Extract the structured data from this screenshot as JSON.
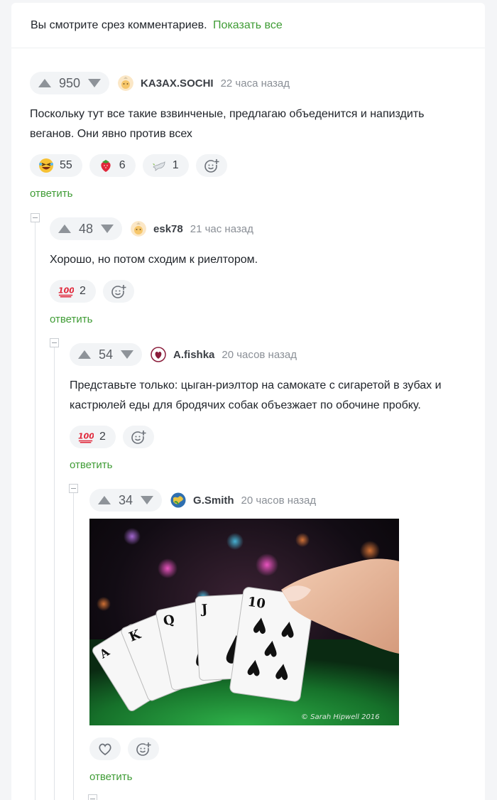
{
  "banner": {
    "text": "Вы смотрите срез комментариев.",
    "link": "Показать все"
  },
  "colors": {
    "accent": "#3f9c35",
    "vote_bg": "#f2f4f6",
    "text": "#1f2329",
    "muted": "#8a8f96"
  },
  "comments": [
    {
      "votes": "950",
      "author": "KA3AX.SOCHI",
      "time": "22 часа назад",
      "text_lines": [
        "Поскольку тут все такие взвинченые, предлагаю объеденится и напиздить",
        "веганов. Они явно против всех"
      ],
      "reactions": [
        {
          "icon": "laughing-emoji",
          "count": "55"
        },
        {
          "icon": "strawberry-emoji",
          "count": "6"
        },
        {
          "icon": "dove-emoji",
          "count": "1"
        }
      ],
      "reply": "ответить"
    },
    {
      "votes": "48",
      "author": "esk78",
      "time": "21 час назад",
      "text_lines": [
        "Хорошо, но потом сходим к риелтором."
      ],
      "reactions": [
        {
          "icon": "hundred-emoji",
          "count": "2"
        }
      ],
      "reply": "ответить"
    },
    {
      "votes": "54",
      "author": "A.fishka",
      "time": "20 часов назад",
      "text_lines": [
        "Представьте только: цыган-риэлтор на самокате с сигаретой в зубах и",
        "кастрюлей еды для бродячих собак объезжает по обочине пробку."
      ],
      "reactions": [
        {
          "icon": "hundred-emoji",
          "count": "2"
        }
      ],
      "reply": "ответить"
    },
    {
      "votes": "34",
      "author": "G.Smith",
      "time": "20 часов назад",
      "image": {
        "watermark": "© Sarah Hipwell 2016",
        "alt": "royal flush of spades held in hand over green poker table"
      },
      "reply": "ответить"
    }
  ]
}
